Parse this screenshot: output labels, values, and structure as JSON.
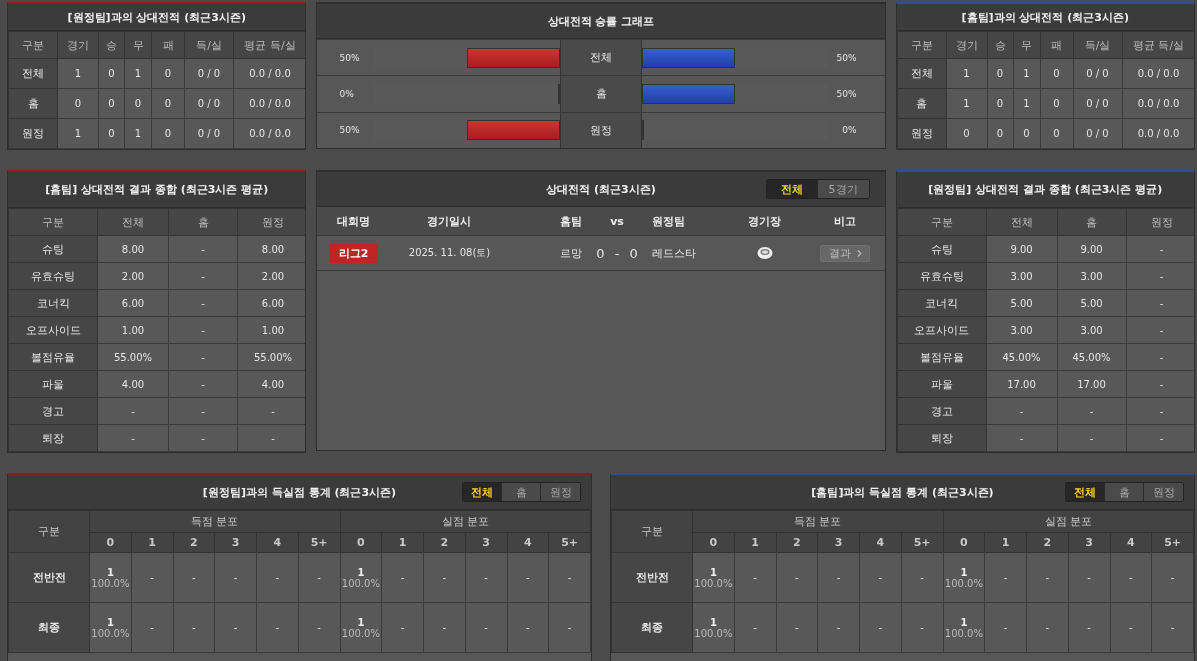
{
  "record_panels": [
    {
      "title": "[원정팀]과의 상대전적 (최근3시즌)",
      "color": "#8e1c1c",
      "columns": [
        "구분",
        "경기",
        "승",
        "무",
        "패",
        "득/실",
        "평균 득/실"
      ],
      "rows": [
        [
          "전체",
          "1",
          "0",
          "1",
          "0",
          "0 / 0",
          "0.0 / 0.0"
        ],
        [
          "홈",
          "0",
          "0",
          "0",
          "0",
          "0 / 0",
          "0.0 / 0.0"
        ],
        [
          "원정",
          "1",
          "0",
          "1",
          "0",
          "0 / 0",
          "0.0 / 0.0"
        ]
      ]
    },
    {
      "title": "[홈팀]과의 상대전적 (최근3시즌)",
      "color": "#2b4f93",
      "columns": [
        "구분",
        "경기",
        "승",
        "무",
        "패",
        "득/실",
        "평균 득/실"
      ],
      "rows": [
        [
          "전체",
          "1",
          "0",
          "1",
          "0",
          "0 / 0",
          "0.0 / 0.0"
        ],
        [
          "홈",
          "1",
          "0",
          "1",
          "0",
          "0 / 0",
          "0.0 / 0.0"
        ],
        [
          "원정",
          "0",
          "0",
          "0",
          "0",
          "0 / 0",
          "0.0 / 0.0"
        ]
      ]
    }
  ],
  "win_rate_graph": {
    "title": "상대전적 승률 그래프",
    "rows": [
      {
        "label": "전체",
        "left": {
          "text": "50%",
          "level": 0.5
        },
        "right": {
          "text": "50%",
          "level": 0.5
        }
      },
      {
        "label": "홈",
        "left": {
          "text": "0%",
          "level": 0
        },
        "right": {
          "text": "50%",
          "level": 0.5
        }
      },
      {
        "label": "원정",
        "left": {
          "text": "50%",
          "level": 0.5
        },
        "right": {
          "text": "0%",
          "level": 0
        }
      }
    ]
  },
  "summary_panels": [
    {
      "title": "[홈팀] 상대전적 결과 종합 (최근3시즌 평균)",
      "color": "#8e1c1c",
      "columns": [
        "구분",
        "전체",
        "홈",
        "원정"
      ],
      "rows": [
        [
          "슈팅",
          "8.00",
          "-",
          "8.00"
        ],
        [
          "유효슈팅",
          "2.00",
          "-",
          "2.00"
        ],
        [
          "코너킥",
          "6.00",
          "-",
          "6.00"
        ],
        [
          "오프사이드",
          "1.00",
          "-",
          "1.00"
        ],
        [
          "볼점유율",
          "55.00%",
          "-",
          "55.00%"
        ],
        [
          "파울",
          "4.00",
          "-",
          "4.00"
        ],
        [
          "경고",
          "-",
          "-",
          "-"
        ],
        [
          "퇴장",
          "-",
          "-",
          "-"
        ]
      ]
    },
    {
      "title": "[원정팀] 상대전적 결과 종합 (최근3시즌 평균)",
      "color": "#2b4f93",
      "columns": [
        "구분",
        "전체",
        "홈",
        "원정"
      ],
      "rows": [
        [
          "슈팅",
          "9.00",
          "9.00",
          "-"
        ],
        [
          "유효슈팅",
          "3.00",
          "3.00",
          "-"
        ],
        [
          "코너킥",
          "5.00",
          "5.00",
          "-"
        ],
        [
          "오프사이드",
          "3.00",
          "3.00",
          "-"
        ],
        [
          "볼점유율",
          "45.00%",
          "45.00%",
          "-"
        ],
        [
          "파울",
          "17.00",
          "17.00",
          "-"
        ],
        [
          "경고",
          "-",
          "-",
          "-"
        ],
        [
          "퇴장",
          "-",
          "-",
          "-"
        ]
      ]
    }
  ],
  "match_list": {
    "title": "상대전적 (최근3시즌)",
    "tabs": [
      {
        "label": "전체",
        "selected": true
      },
      {
        "label": "5경기",
        "selected": false
      }
    ],
    "columns": {
      "competition": "대회명",
      "date": "경기일시",
      "home": "홈팀",
      "vs": "vs",
      "away": "원정팀",
      "stadium": "경기장",
      "note": "비고"
    },
    "matches": [
      {
        "competition": "리그2",
        "date": "2025. 11. 08(토)",
        "home": "르망",
        "score": "0 - 0",
        "away": "레드스타",
        "result_button": "결과"
      }
    ]
  },
  "goal_stats": [
    {
      "title": "[원정팀]과의 득실점 통계 (최근3시즌)",
      "color": "#8e1c1c",
      "tabs": [
        {
          "label": "전체",
          "selected": true
        },
        {
          "label": "홈",
          "selected": false
        },
        {
          "label": "원정",
          "selected": false
        }
      ],
      "row_header": "구분",
      "scored_label": "득점 분포",
      "conceded_label": "실점 분포",
      "scored_columns": [
        "0",
        "1",
        "2",
        "3",
        "4",
        "5+"
      ],
      "conceded_columns": [
        "0",
        "1",
        "2",
        "3",
        "4",
        "5+"
      ],
      "rows": [
        {
          "label": "전반전",
          "cells": [
            {
              "count": "1",
              "percent": "100.0%"
            },
            "-",
            "-",
            "-",
            "-",
            "-",
            {
              "count": "1",
              "percent": "100.0%"
            },
            "-",
            "-",
            "-",
            "-",
            "-"
          ]
        },
        {
          "label": "최종",
          "cells": [
            {
              "count": "1",
              "percent": "100.0%"
            },
            "-",
            "-",
            "-",
            "-",
            "-",
            {
              "count": "1",
              "percent": "100.0%"
            },
            "-",
            "-",
            "-",
            "-",
            "-"
          ]
        }
      ]
    },
    {
      "title": "[홈팀]과의 득실점 통계 (최근3시즌)",
      "color": "#2b4f93",
      "tabs": [
        {
          "label": "전체",
          "selected": true
        },
        {
          "label": "홈",
          "selected": false
        },
        {
          "label": "원정",
          "selected": false
        }
      ],
      "row_header": "구분",
      "scored_label": "득점 분포",
      "conceded_label": "실점 분포",
      "scored_columns": [
        "0",
        "1",
        "2",
        "3",
        "4",
        "5+"
      ],
      "conceded_columns": [
        "0",
        "1",
        "2",
        "3",
        "4",
        "5+"
      ],
      "rows": [
        {
          "label": "전반전",
          "cells": [
            {
              "count": "1",
              "percent": "100.0%"
            },
            "-",
            "-",
            "-",
            "-",
            "-",
            {
              "count": "1",
              "percent": "100.0%"
            },
            "-",
            "-",
            "-",
            "-",
            "-"
          ]
        },
        {
          "label": "최종",
          "cells": [
            {
              "count": "1",
              "percent": "100.0%"
            },
            "-",
            "-",
            "-",
            "-",
            "-",
            {
              "count": "1",
              "percent": "100.0%"
            },
            "-",
            "-",
            "-",
            "-",
            "-"
          ]
        }
      ]
    }
  ]
}
